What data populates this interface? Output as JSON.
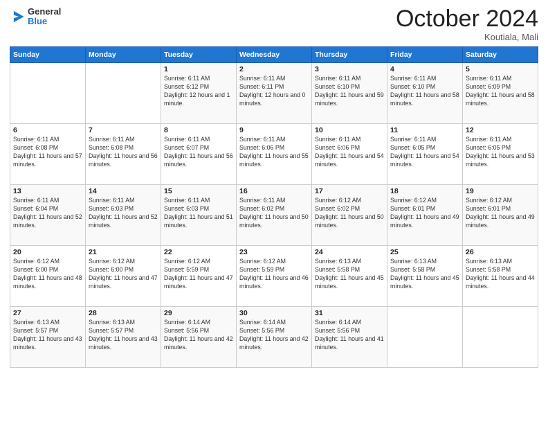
{
  "logo": {
    "general": "General",
    "blue": "Blue"
  },
  "header": {
    "month": "October 2024",
    "location": "Koutiala, Mali"
  },
  "weekdays": [
    "Sunday",
    "Monday",
    "Tuesday",
    "Wednesday",
    "Thursday",
    "Friday",
    "Saturday"
  ],
  "weeks": [
    [
      {
        "day": "",
        "info": ""
      },
      {
        "day": "",
        "info": ""
      },
      {
        "day": "1",
        "info": "Sunrise: 6:11 AM\nSunset: 6:12 PM\nDaylight: 12 hours and 1 minute."
      },
      {
        "day": "2",
        "info": "Sunrise: 6:11 AM\nSunset: 6:11 PM\nDaylight: 12 hours and 0 minutes."
      },
      {
        "day": "3",
        "info": "Sunrise: 6:11 AM\nSunset: 6:10 PM\nDaylight: 11 hours and 59 minutes."
      },
      {
        "day": "4",
        "info": "Sunrise: 6:11 AM\nSunset: 6:10 PM\nDaylight: 11 hours and 58 minutes."
      },
      {
        "day": "5",
        "info": "Sunrise: 6:11 AM\nSunset: 6:09 PM\nDaylight: 11 hours and 58 minutes."
      }
    ],
    [
      {
        "day": "6",
        "info": "Sunrise: 6:11 AM\nSunset: 6:08 PM\nDaylight: 11 hours and 57 minutes."
      },
      {
        "day": "7",
        "info": "Sunrise: 6:11 AM\nSunset: 6:08 PM\nDaylight: 11 hours and 56 minutes."
      },
      {
        "day": "8",
        "info": "Sunrise: 6:11 AM\nSunset: 6:07 PM\nDaylight: 11 hours and 56 minutes."
      },
      {
        "day": "9",
        "info": "Sunrise: 6:11 AM\nSunset: 6:06 PM\nDaylight: 11 hours and 55 minutes."
      },
      {
        "day": "10",
        "info": "Sunrise: 6:11 AM\nSunset: 6:06 PM\nDaylight: 11 hours and 54 minutes."
      },
      {
        "day": "11",
        "info": "Sunrise: 6:11 AM\nSunset: 6:05 PM\nDaylight: 11 hours and 54 minutes."
      },
      {
        "day": "12",
        "info": "Sunrise: 6:11 AM\nSunset: 6:05 PM\nDaylight: 11 hours and 53 minutes."
      }
    ],
    [
      {
        "day": "13",
        "info": "Sunrise: 6:11 AM\nSunset: 6:04 PM\nDaylight: 11 hours and 52 minutes."
      },
      {
        "day": "14",
        "info": "Sunrise: 6:11 AM\nSunset: 6:03 PM\nDaylight: 11 hours and 52 minutes."
      },
      {
        "day": "15",
        "info": "Sunrise: 6:11 AM\nSunset: 6:03 PM\nDaylight: 11 hours and 51 minutes."
      },
      {
        "day": "16",
        "info": "Sunrise: 6:11 AM\nSunset: 6:02 PM\nDaylight: 11 hours and 50 minutes."
      },
      {
        "day": "17",
        "info": "Sunrise: 6:12 AM\nSunset: 6:02 PM\nDaylight: 11 hours and 50 minutes."
      },
      {
        "day": "18",
        "info": "Sunrise: 6:12 AM\nSunset: 6:01 PM\nDaylight: 11 hours and 49 minutes."
      },
      {
        "day": "19",
        "info": "Sunrise: 6:12 AM\nSunset: 6:01 PM\nDaylight: 11 hours and 49 minutes."
      }
    ],
    [
      {
        "day": "20",
        "info": "Sunrise: 6:12 AM\nSunset: 6:00 PM\nDaylight: 11 hours and 48 minutes."
      },
      {
        "day": "21",
        "info": "Sunrise: 6:12 AM\nSunset: 6:00 PM\nDaylight: 11 hours and 47 minutes."
      },
      {
        "day": "22",
        "info": "Sunrise: 6:12 AM\nSunset: 5:59 PM\nDaylight: 11 hours and 47 minutes."
      },
      {
        "day": "23",
        "info": "Sunrise: 6:12 AM\nSunset: 5:59 PM\nDaylight: 11 hours and 46 minutes."
      },
      {
        "day": "24",
        "info": "Sunrise: 6:13 AM\nSunset: 5:58 PM\nDaylight: 11 hours and 45 minutes."
      },
      {
        "day": "25",
        "info": "Sunrise: 6:13 AM\nSunset: 5:58 PM\nDaylight: 11 hours and 45 minutes."
      },
      {
        "day": "26",
        "info": "Sunrise: 6:13 AM\nSunset: 5:58 PM\nDaylight: 11 hours and 44 minutes."
      }
    ],
    [
      {
        "day": "27",
        "info": "Sunrise: 6:13 AM\nSunset: 5:57 PM\nDaylight: 11 hours and 43 minutes."
      },
      {
        "day": "28",
        "info": "Sunrise: 6:13 AM\nSunset: 5:57 PM\nDaylight: 11 hours and 43 minutes."
      },
      {
        "day": "29",
        "info": "Sunrise: 6:14 AM\nSunset: 5:56 PM\nDaylight: 11 hours and 42 minutes."
      },
      {
        "day": "30",
        "info": "Sunrise: 6:14 AM\nSunset: 5:56 PM\nDaylight: 11 hours and 42 minutes."
      },
      {
        "day": "31",
        "info": "Sunrise: 6:14 AM\nSunset: 5:56 PM\nDaylight: 11 hours and 41 minutes."
      },
      {
        "day": "",
        "info": ""
      },
      {
        "day": "",
        "info": ""
      }
    ]
  ]
}
